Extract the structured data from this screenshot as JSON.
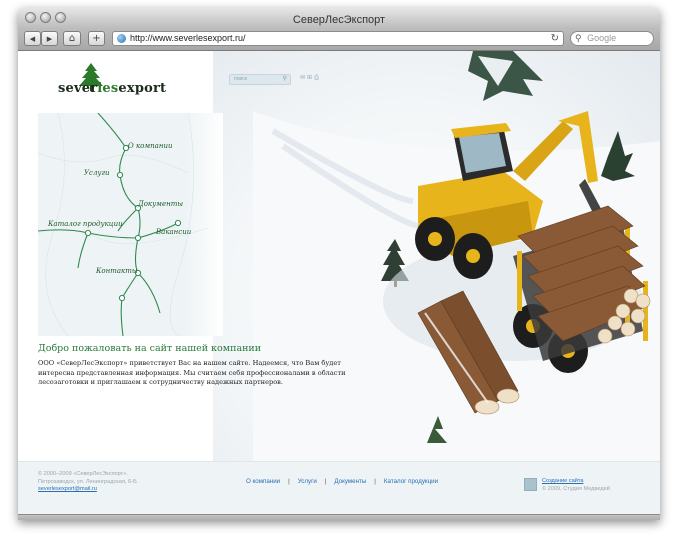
{
  "browser": {
    "window_title": "СеверЛесЭкспорт",
    "url": "http://www.severlesexport.ru/",
    "search_placeholder": "Google",
    "back_glyph": "◀",
    "forward_glyph": "▶",
    "home_glyph": "⌂",
    "add_glyph": "+",
    "reload_glyph": "↻",
    "search_glyph": "⚲"
  },
  "site": {
    "logo_prefix": "sever",
    "logo_les": "les",
    "logo_suffix": "export",
    "search_placeholder": "поиск",
    "nav_map": [
      {
        "label": "О компании"
      },
      {
        "label": "Услуги"
      },
      {
        "label": "Документы"
      },
      {
        "label": "Каталог продукции"
      },
      {
        "label": "Вакансии"
      },
      {
        "label": "Контакты"
      }
    ],
    "welcome_title": "Добро пожаловать на сайт нашей компании",
    "welcome_text": "ООО «СеверЛесЭкспорт» приветствует Вас на нашем сайте. Надеемся, что Вам будет интересна представленная информация. Мы считаем себя профессионалами в области лесозаготовки и приглашаем к сотрудничеству надежных партнеров."
  },
  "footer": {
    "copyright": "© 2000–2009 «СеверЛесЭкспорт».",
    "address": "Петрозаводск, ул. Ленинградская, 6-Б",
    "email": "severlesexport@mail.ru",
    "nav": [
      "О компании",
      "Услуги",
      "Документы",
      "Каталог продукции"
    ],
    "studio_link": "Создание сайта",
    "studio_credit": "© 2009, Студия Медведей"
  },
  "colors": {
    "accent_green": "#2a7a3a",
    "link_blue": "#2a6fb5",
    "machine_yellow": "#e8b41c"
  }
}
